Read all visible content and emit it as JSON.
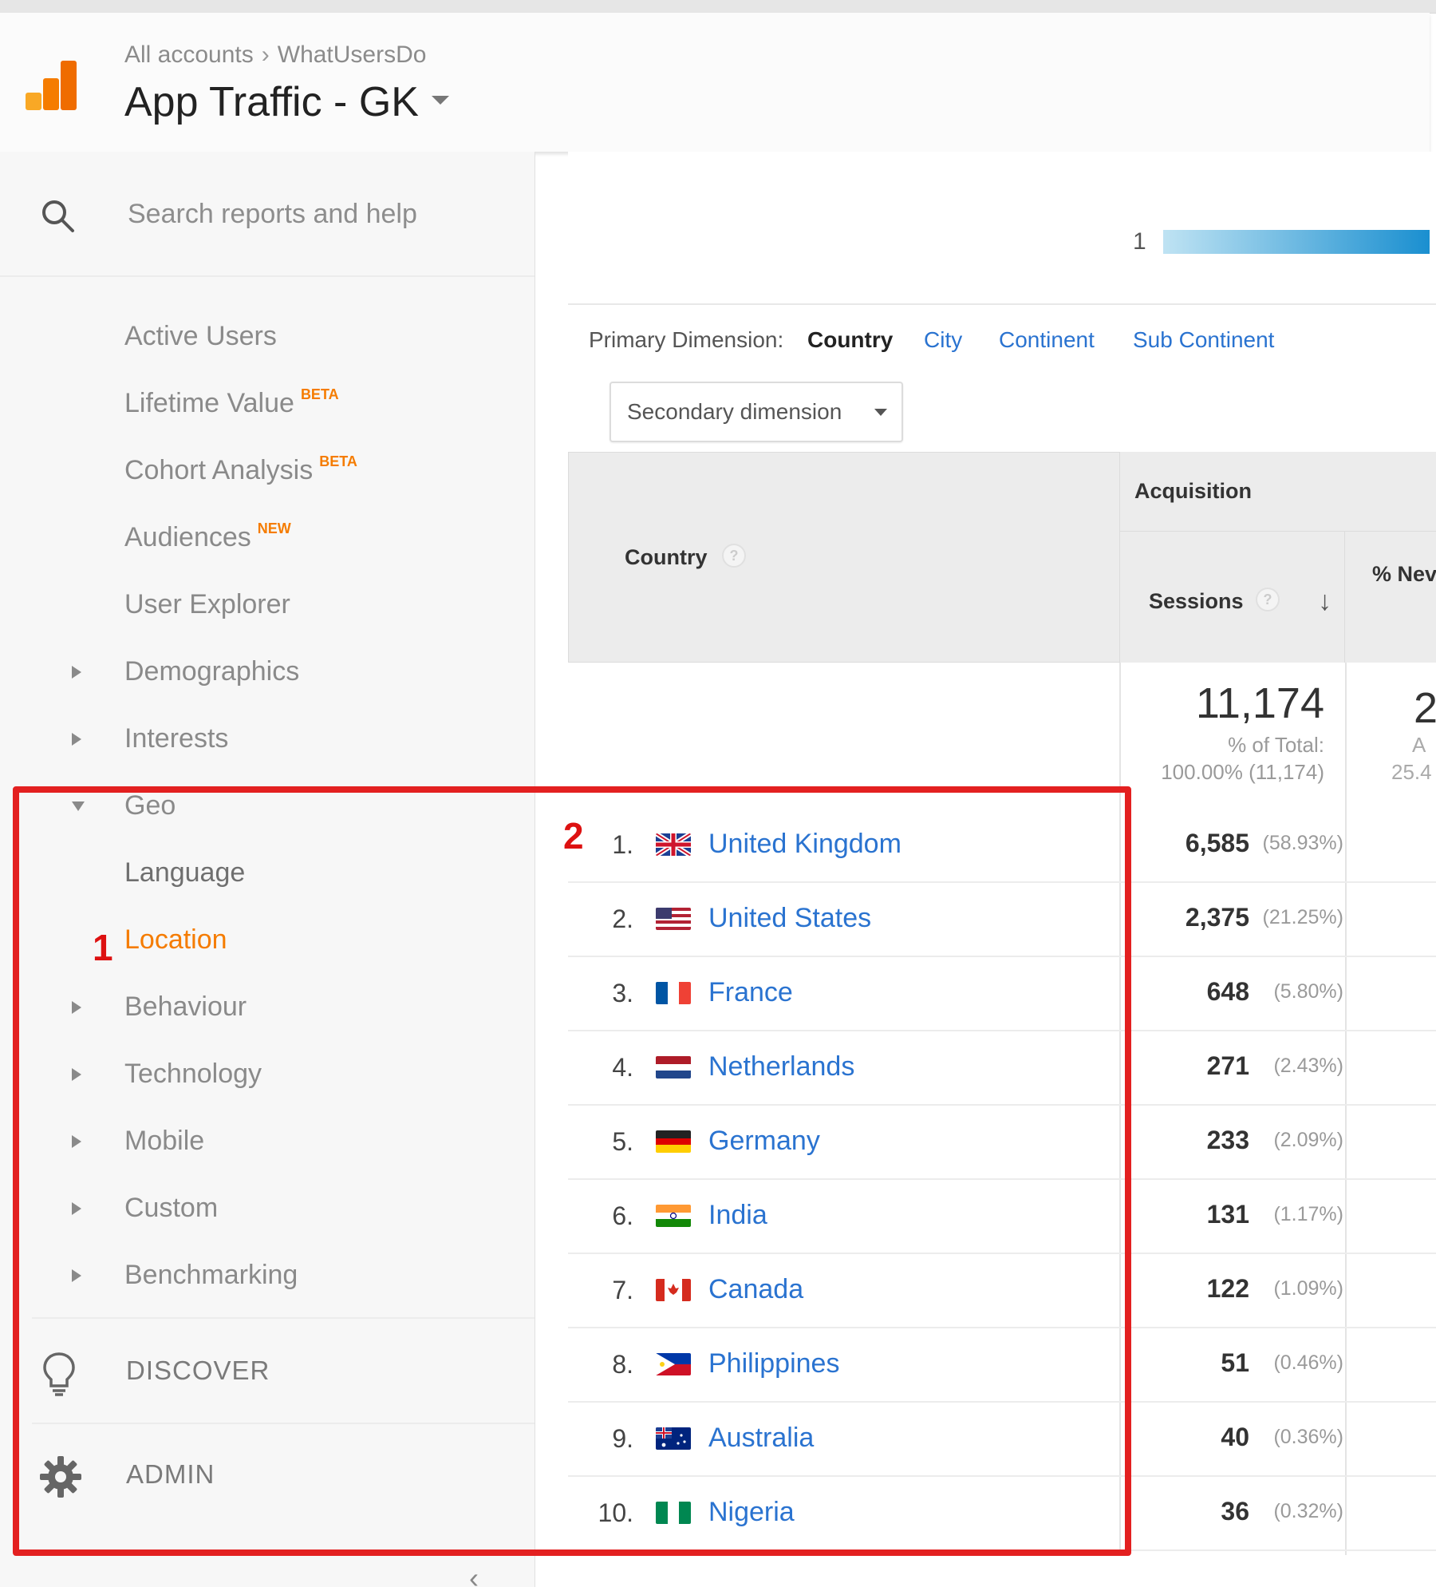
{
  "colors": {
    "accent_orange": "#f57c00",
    "link_blue": "#2a73d0",
    "annotation_red": "#e32020"
  },
  "header": {
    "breadcrumb_root": "All accounts",
    "breadcrumb_account": "WhatUsersDo",
    "property_title": "App Traffic - GK"
  },
  "sidebar": {
    "search_placeholder": "Search reports and help",
    "items": [
      {
        "label": "Active Users"
      },
      {
        "label": "Lifetime Value",
        "badge": "BETA"
      },
      {
        "label": "Cohort Analysis",
        "badge": "BETA"
      },
      {
        "label": "Audiences",
        "badge": "NEW"
      },
      {
        "label": "User Explorer"
      },
      {
        "label": "Demographics"
      },
      {
        "label": "Interests"
      },
      {
        "label": "Geo"
      },
      {
        "label": "Language"
      },
      {
        "label": "Location"
      },
      {
        "label": "Behaviour"
      },
      {
        "label": "Technology"
      },
      {
        "label": "Mobile"
      },
      {
        "label": "Custom"
      },
      {
        "label": "Benchmarking"
      }
    ],
    "discover_label": "DISCOVER",
    "admin_label": "ADMIN",
    "collapse_glyph": "‹"
  },
  "map": {
    "legend_value": "1"
  },
  "dimensions": {
    "primary_label": "Primary Dimension:",
    "current": "Country",
    "options": [
      "City",
      "Continent",
      "Sub Continent"
    ],
    "secondary_button": "Secondary dimension"
  },
  "table": {
    "col_country": "Country",
    "group_acquisition": "Acquisition",
    "col_sessions": "Sessions",
    "col_new_partial": "% Nev",
    "totals": {
      "sessions": "11,174",
      "sessions_pct_label": "% of Total:",
      "sessions_pct_value": "100.00% (11,174)",
      "next_col_partial": "2",
      "next_col_sub1": "A",
      "next_col_sub2": "25.4"
    },
    "rows": [
      {
        "rank": "1.",
        "country": "United Kingdom",
        "sessions": "6,585",
        "pct": "(58.93%)"
      },
      {
        "rank": "2.",
        "country": "United States",
        "sessions": "2,375",
        "pct": "(21.25%)"
      },
      {
        "rank": "3.",
        "country": "France",
        "sessions": "648",
        "pct": "(5.80%)"
      },
      {
        "rank": "4.",
        "country": "Netherlands",
        "sessions": "271",
        "pct": "(2.43%)"
      },
      {
        "rank": "5.",
        "country": "Germany",
        "sessions": "233",
        "pct": "(2.09%)"
      },
      {
        "rank": "6.",
        "country": "India",
        "sessions": "131",
        "pct": "(1.17%)"
      },
      {
        "rank": "7.",
        "country": "Canada",
        "sessions": "122",
        "pct": "(1.09%)"
      },
      {
        "rank": "8.",
        "country": "Philippines",
        "sessions": "51",
        "pct": "(0.46%)"
      },
      {
        "rank": "9.",
        "country": "Australia",
        "sessions": "40",
        "pct": "(0.36%)"
      },
      {
        "rank": "10.",
        "country": "Nigeria",
        "sessions": "36",
        "pct": "(0.32%)"
      }
    ]
  },
  "annotations": {
    "mark_1": "1",
    "mark_2": "2"
  }
}
